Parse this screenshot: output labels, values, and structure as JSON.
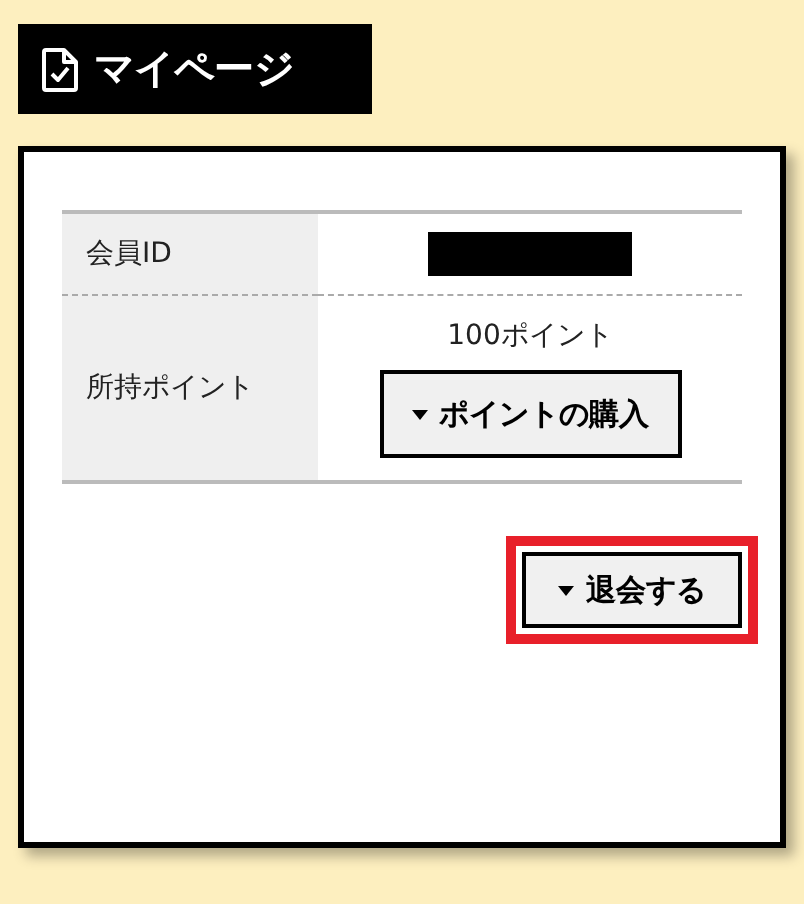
{
  "header": {
    "title": "マイページ"
  },
  "table": {
    "rows": [
      {
        "kind": "id",
        "label": "会員ID",
        "redacted": true
      },
      {
        "kind": "points",
        "label": "所持ポイント",
        "value": "100ポイント",
        "button": "ポイントの購入"
      }
    ]
  },
  "withdraw_button": {
    "label": "退会する",
    "highlighted": true
  }
}
